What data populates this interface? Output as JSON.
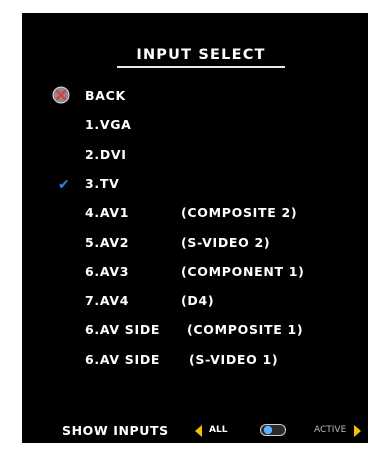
{
  "menu": {
    "title": "INPUT SELECT",
    "items": [
      {
        "label": "BACK",
        "desc": "",
        "icon": "back-icon"
      },
      {
        "label": "1.VGA",
        "desc": ""
      },
      {
        "label": "2.DVI",
        "desc": ""
      },
      {
        "label": "3.TV",
        "desc": "",
        "icon": "checkmark-icon",
        "selected": true
      },
      {
        "label": "4.AV1",
        "desc": "(COMPOSITE 2)"
      },
      {
        "label": "5.AV2",
        "desc": "(S-VIDEO 2)"
      },
      {
        "label": "6.AV3",
        "desc": "(COMPONENT 1)"
      },
      {
        "label": "7.AV4",
        "desc": "(D4)"
      },
      {
        "label": "6.AV SIDE",
        "desc": "(COMPOSITE 1)"
      },
      {
        "label": "6.AV SIDE",
        "desc": "(S-VIDEO 1)"
      }
    ]
  },
  "footer": {
    "show_inputs_label": "SHOW INPUTS",
    "all_label": "ALL",
    "active_label": "ACTIVE"
  },
  "colors": {
    "background": "#000000",
    "text": "#ffffff",
    "arrow": "#f2c300",
    "checkmark": "#2f86e8",
    "toggle": "#58b2ff"
  }
}
